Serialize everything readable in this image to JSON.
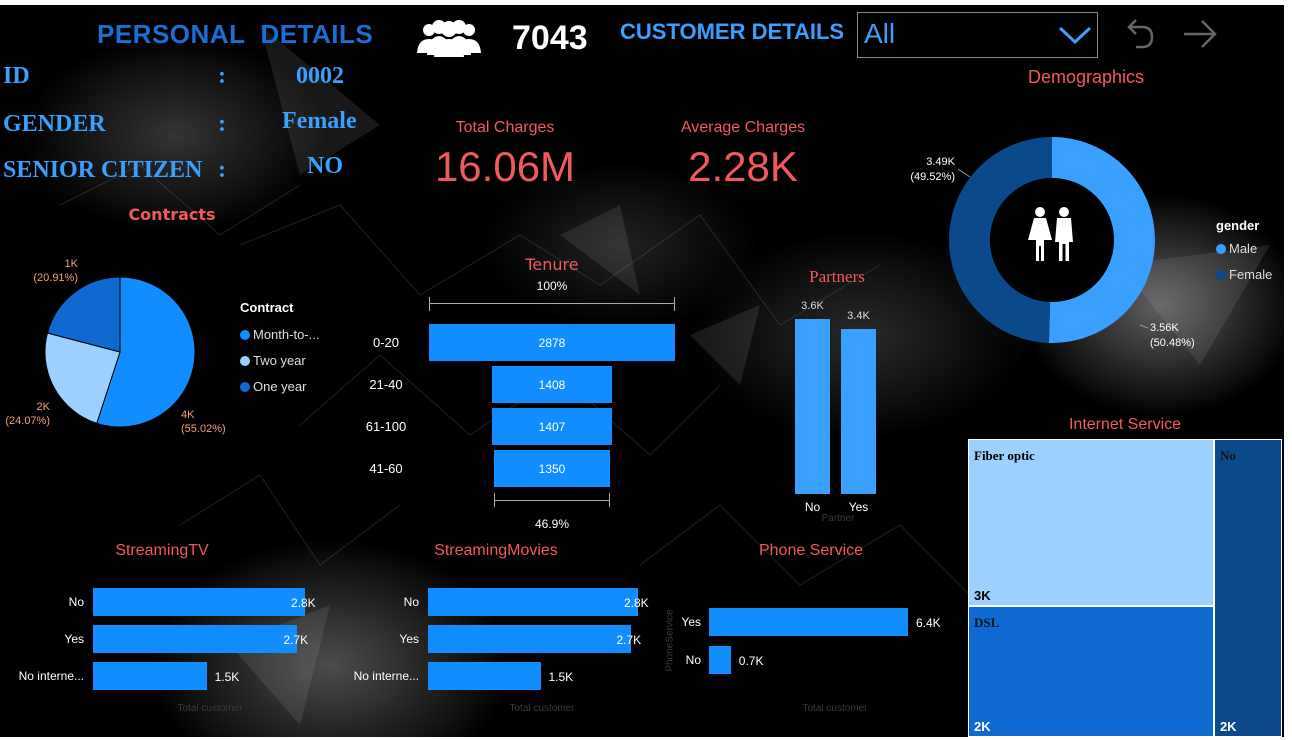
{
  "colors": {
    "accent_blue": "#1e90ff",
    "title_red": "#f05a5f",
    "bar_blue": "#118dff",
    "background": "#000000"
  },
  "header": {
    "personal_title": "PERSONAL  DETAILS",
    "customers_icon": "people-group-icon",
    "customer_count": "7043",
    "customer_details_title": "CUSTOMER DETAILS",
    "filter_value": "All",
    "back_icon": "undo-arrow-icon",
    "forward_icon": "forward-arrow-icon"
  },
  "personal": {
    "rows": [
      {
        "label": "ID",
        "sep": ":",
        "value": "0002"
      },
      {
        "label": "GENDER",
        "sep": ":",
        "value": "Female"
      },
      {
        "label": "SENIOR CITIZEN",
        "sep": ":",
        "value": "NO"
      }
    ]
  },
  "kpis": [
    {
      "title": "Total Charges",
      "value": "16.06M"
    },
    {
      "title": "Average Charges",
      "value": "2.28K"
    }
  ],
  "chart_data": [
    {
      "id": "contracts",
      "type": "pie",
      "title": "Contracts",
      "legend_title": "Contract",
      "legend_placement": "right",
      "categories": [
        "Month-to-month",
        "Two year",
        "One year"
      ],
      "legend_labels": [
        "Month-to-...",
        "Two year",
        "One year"
      ],
      "values": [
        3875,
        1695,
        1473
      ],
      "colors": [
        "#118dff",
        "#9cd0ff",
        "#0e6ad0"
      ],
      "data_labels": [
        {
          "value": "4K",
          "pct": "(55.02%)"
        },
        {
          "value": "2K",
          "pct": "(24.07%)"
        },
        {
          "value": "1K",
          "pct": "(20.91%)"
        }
      ]
    },
    {
      "id": "tenure",
      "type": "bar",
      "title": "Tenure",
      "orientation": "funnel",
      "categories": [
        "0-20",
        "21-40",
        "61-100",
        "41-60"
      ],
      "values": [
        2878,
        1408,
        1407,
        1350
      ],
      "value_labels": [
        "2878",
        "1408",
        "1407",
        "1350"
      ],
      "top_pct": "100%",
      "bottom_pct": "46.9%"
    },
    {
      "id": "partners",
      "type": "bar",
      "title": "Partners",
      "xlabel": "Partner",
      "categories": [
        "No",
        "Yes"
      ],
      "values": [
        3.6,
        3.4
      ],
      "value_labels": [
        "3.6K",
        "3.4K"
      ]
    },
    {
      "id": "demographics",
      "type": "pie",
      "title": "Demographics",
      "donut": true,
      "legend_title": "gender",
      "legend_placement": "right",
      "categories": [
        "Male",
        "Female"
      ],
      "values": [
        3555,
        3488
      ],
      "colors": [
        "#3aa0ff",
        "#0a4a8a"
      ],
      "data_labels": [
        {
          "value": "3.56K",
          "pct": "(50.48%)"
        },
        {
          "value": "3.49K",
          "pct": "(49.52%)"
        }
      ],
      "center_icon": "restroom-people-icon"
    },
    {
      "id": "streaming_tv",
      "type": "bar",
      "title": "StreamingTV",
      "orientation": "horizontal",
      "xlabel": "Total customer",
      "categories": [
        "No",
        "Yes",
        "No interne..."
      ],
      "values": [
        2.8,
        2.7,
        1.5
      ],
      "value_labels": [
        "2.8K",
        "2.7K",
        "1.5K"
      ]
    },
    {
      "id": "streaming_movies",
      "type": "bar",
      "title": "StreamingMovies",
      "orientation": "horizontal",
      "xlabel": "Total customer",
      "categories": [
        "No",
        "Yes",
        "No interne..."
      ],
      "values": [
        2.8,
        2.7,
        1.5
      ],
      "value_labels": [
        "2.8K",
        "2.7K",
        "1.5K"
      ]
    },
    {
      "id": "phone_service",
      "type": "bar",
      "title": "Phone Service",
      "orientation": "horizontal",
      "xlabel": "Total customer",
      "ylabel": "PhoneService",
      "categories": [
        "Yes",
        "No"
      ],
      "values": [
        6.4,
        0.7
      ],
      "value_labels": [
        "6.4K",
        "0.7K"
      ]
    },
    {
      "id": "internet_service",
      "type": "treemap",
      "title": "Internet Service",
      "categories": [
        "Fiber optic",
        "DSL",
        "No"
      ],
      "values": [
        3096,
        2421,
        1526
      ],
      "value_labels": [
        "3K",
        "2K",
        "2K"
      ],
      "colors": [
        "#9cd0ff",
        "#0e6ad0",
        "#0a4a8a"
      ]
    }
  ]
}
